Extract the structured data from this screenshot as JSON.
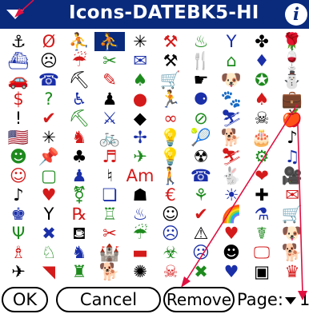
{
  "window": {
    "title": "Icons-DATEBK5-HI",
    "info_glyph": "i"
  },
  "icons": [
    [
      "⚓",
      "Ø",
      "⛹",
      "⛹",
      "✳",
      "⚒",
      "♨",
      "Y",
      "✤",
      "🌹",
      "",
      ""
    ],
    [
      "⛴",
      "☹",
      "☔",
      "✂",
      "✉",
      "⚒",
      "🍴",
      "⌂",
      "♦",
      "🍷",
      "",
      ""
    ],
    [
      "🚗",
      "☎",
      "⛏",
      "✎",
      "♠",
      "🛒",
      "☛",
      "🐶",
      "✪",
      "⛄",
      "",
      ""
    ],
    [
      "$",
      "?",
      "♿",
      "♟",
      "●",
      "🏃",
      "⚈",
      "🐾",
      "♠",
      "💼",
      "",
      ""
    ],
    [
      "!",
      "✔",
      "⛏",
      "⚔",
      "◆",
      "∞",
      "⊘",
      "⛷",
      "☠",
      "🍎",
      "",
      ""
    ],
    [
      "🇺🇸",
      "✳",
      "♞",
      "🚲",
      "✢",
      "💡",
      "🎾",
      "🐕",
      "🎂",
      "♪",
      "",
      ""
    ],
    [
      "☻",
      "📌",
      "♣",
      "♬",
      "✈",
      "💡",
      "☢",
      "⛷",
      "⚙",
      "♫",
      "",
      ""
    ],
    [
      "☺",
      "▢",
      "♟",
      "♮",
      "Am",
      "🚶",
      "☎",
      "🐇",
      "❤",
      "🎥",
      "",
      ""
    ],
    [
      "♪",
      "♥",
      "⚧",
      "❏",
      "☗",
      "€",
      "⚘",
      "☀",
      "✚",
      "✉",
      "",
      ""
    ],
    [
      "♚",
      "Y",
      "℞",
      "♖",
      "♨",
      "☺",
      "✔",
      "🌈",
      "⚗",
      "🛒",
      "",
      ""
    ],
    [
      "Ψ",
      "✖",
      "⛾",
      "✂",
      "☔",
      "☹",
      "⚠",
      "♥",
      "☤",
      "🐶",
      "",
      ""
    ],
    [
      "♗",
      "♘",
      "♞",
      "🏰",
      "▬",
      "☣",
      "☹",
      "☻",
      "🖵",
      "🐕",
      "",
      ""
    ],
    [
      "✈",
      "◥",
      "♜",
      "🐕",
      "✺",
      "☠",
      "✖",
      "♥",
      "▣",
      "♛",
      "",
      ""
    ]
  ],
  "icon_colors": [
    "#000000",
    "#d41a1a",
    "#1d8a1d",
    "#1a2fa8",
    "#000000",
    "#d41a1a",
    "#1d8a1d",
    "#1a2fa8",
    "#000000",
    "#d41a1a",
    "#1d8a1d",
    "#1a2fa8"
  ],
  "buttons": {
    "ok": "OK",
    "cancel": "Cancel",
    "remove": "Remove"
  },
  "pager": {
    "label": "Page:",
    "value": "1"
  }
}
